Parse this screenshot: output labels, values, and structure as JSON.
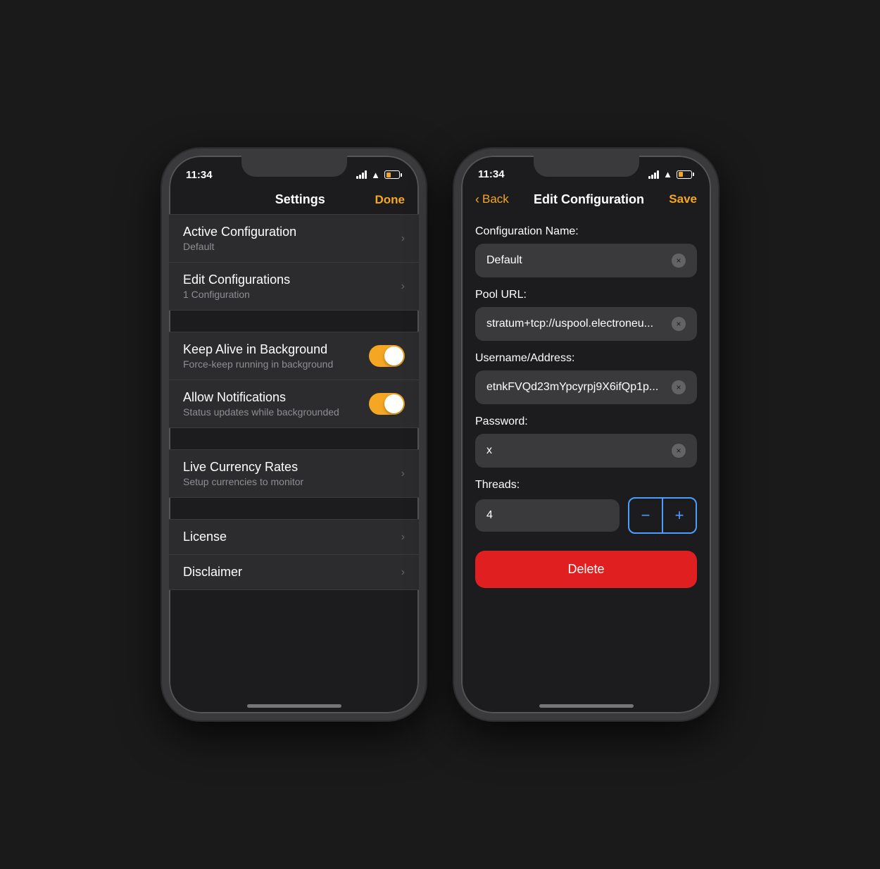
{
  "phone1": {
    "statusBar": {
      "time": "11:34",
      "signal": "signal",
      "wifi": "wifi",
      "battery": "battery"
    },
    "navBar": {
      "title": "Settings",
      "doneBtn": "Done"
    },
    "items": [
      {
        "title": "Active Configuration",
        "subtitle": "Default",
        "hasChevron": true,
        "hasToggle": false,
        "groupStart": true
      },
      {
        "title": "Edit Configurations",
        "subtitle": "1 Configuration",
        "hasChevron": true,
        "hasToggle": false,
        "groupStart": false
      },
      {
        "title": "Keep Alive in Background",
        "subtitle": "Force-keep running in background",
        "hasChevron": false,
        "hasToggle": true,
        "groupStart": true
      },
      {
        "title": "Allow Notifications",
        "subtitle": "Status updates while backgrounded",
        "hasChevron": false,
        "hasToggle": true,
        "groupStart": false
      },
      {
        "title": "Live Currency Rates",
        "subtitle": "Setup currencies to monitor",
        "hasChevron": true,
        "hasToggle": false,
        "groupStart": true
      },
      {
        "title": "License",
        "subtitle": "",
        "hasChevron": true,
        "hasToggle": false,
        "groupStart": true
      },
      {
        "title": "Disclaimer",
        "subtitle": "",
        "hasChevron": true,
        "hasToggle": false,
        "groupStart": false
      }
    ],
    "homeIndicator": true
  },
  "phone2": {
    "statusBar": {
      "time": "11:34"
    },
    "navBar": {
      "backBtn": "Back",
      "title": "Edit Configuration",
      "saveBtn": "Save"
    },
    "fields": [
      {
        "label": "Configuration Name:",
        "value": "Default",
        "placeholder": "Default"
      },
      {
        "label": "Pool URL:",
        "value": "stratum+tcp://uspool.electroneu...",
        "placeholder": ""
      },
      {
        "label": "Username/Address:",
        "value": "etnkFVQd23mYpcyrpj9X6ifQp1p...",
        "placeholder": ""
      },
      {
        "label": "Password:",
        "value": "x",
        "placeholder": ""
      }
    ],
    "threadsLabel": "Threads:",
    "threadsValue": "4",
    "decrementBtn": "−",
    "incrementBtn": "+",
    "deleteBtn": "Delete",
    "homeIndicator": true
  },
  "icons": {
    "chevronRight": "›",
    "chevronLeft": "‹",
    "close": "×"
  }
}
